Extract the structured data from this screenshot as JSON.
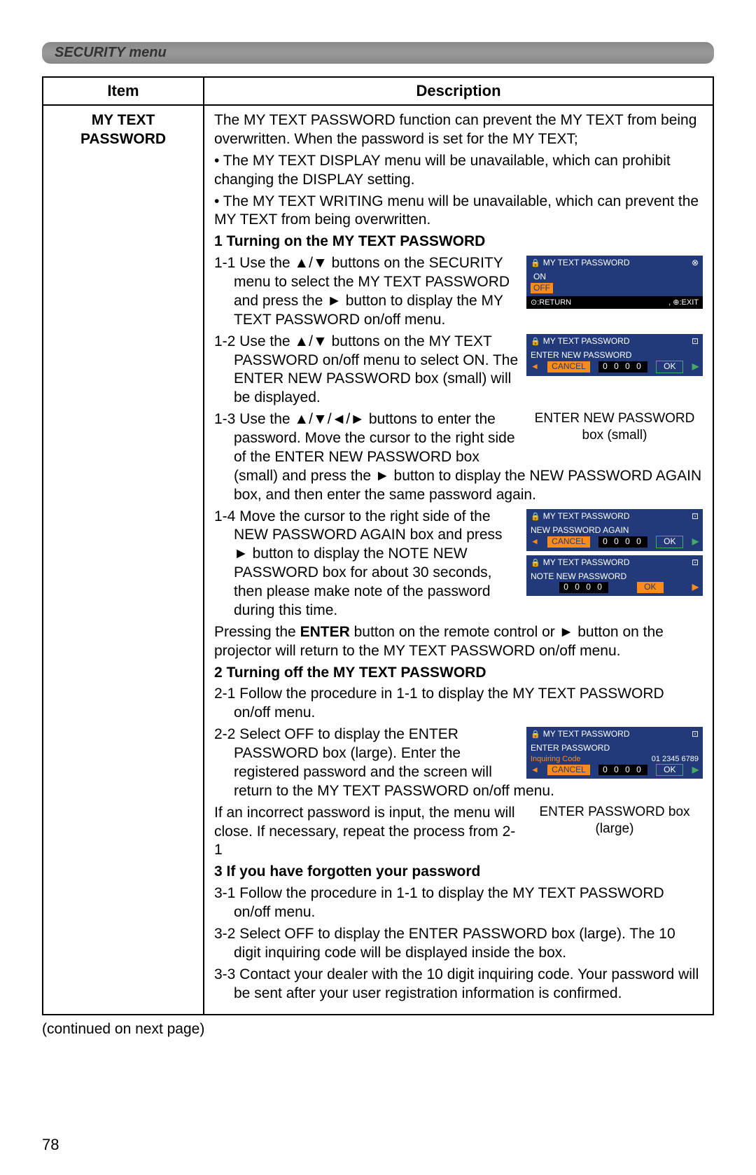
{
  "header": "SECURITY menu",
  "table": {
    "col1": "Item",
    "col2": "Description",
    "item_name_line1": "MY TEXT",
    "item_name_line2": "PASSWORD",
    "intro": {
      "p1": "The MY TEXT PASSWORD function can prevent the MY TEXT from being overwritten. When the password is set for the MY TEXT;",
      "b1": "• The MY TEXT DISPLAY menu will be unavailable, which can prohibit changing the DISPLAY setting.",
      "b2": "• The MY TEXT WRITING menu will be unavailable, which can prevent the MY TEXT from being overwritten."
    },
    "sec1": {
      "title": "1 Turning on the MY TEXT PASSWORD",
      "s11": "1-1 Use the ▲/▼ buttons on the SECURITY menu to select the MY TEXT PASSWORD and press the ► button to display the MY TEXT PASSWORD on/off menu.",
      "s12": "1-2 Use the ▲/▼ buttons on the MY TEXT PASSWORD on/off menu to select ON. The ENTER NEW PASSWORD box (small) will be displayed.",
      "s13": "1-3 Use the ▲/▼/◄/► buttons to enter the password. Move the cursor to the right side of the ENTER NEW PASSWORD box (small) and press the ► button to display the NEW PASSWORD AGAIN box, and then enter the same password again.",
      "s14": "1-4 Move the cursor to the right side of the NEW PASSWORD AGAIN box and press ► button to display the NOTE NEW PASSWORD box for about 30 seconds, then please make note of the password during this time.",
      "note": "Pressing the ENTER button on the remote control or ► button on the projector will return to the MY TEXT PASSWORD on/off menu."
    },
    "caption1": "ENTER NEW PASSWORD box (small)",
    "sec2": {
      "title": "2 Turning off the MY TEXT PASSWORD",
      "s21": "2-1 Follow the procedure in 1-1 to display the MY TEXT PASSWORD on/off menu.",
      "s22": "2-2 Select OFF to display the ENTER PASSWORD box (large). Enter the registered password and the screen will return to the MY TEXT PASSWORD on/off menu.",
      "note": "If an incorrect password is input, the menu will close. If necessary, repeat the process from 2-1"
    },
    "caption2": "ENTER PASSWORD box (large)",
    "sec3": {
      "title": "3 If you have forgotten your password",
      "s31": "3-1 Follow the procedure in 1-1 to display the MY TEXT PASSWORD on/off menu.",
      "s32": "3-2 Select OFF to display the ENTER PASSWORD box (large). The 10 digit inquiring code will be displayed inside the box.",
      "s33": "3-3 Contact your dealer with the 10 digit inquiring code. Your password will be sent after your user registration information is confirmed."
    }
  },
  "insets": {
    "title": "MY TEXT PASSWORD",
    "on": "ON",
    "off": "OFF",
    "return": "⊙:RETURN",
    "exit": ", ⊕:EXIT",
    "enter_new": "ENTER NEW PASSWORD",
    "cancel": "CANCEL",
    "digits4": "0 0 0 0",
    "ok": "OK",
    "new_again": "NEW PASSWORD AGAIN",
    "note_new": "NOTE NEW PASSWORD",
    "enter_pw": "ENTER PASSWORD",
    "inq_label": "Inquiring Code",
    "inq_code": "01 2345 6789"
  },
  "continued": "(continued on next page)",
  "page_number": "78"
}
